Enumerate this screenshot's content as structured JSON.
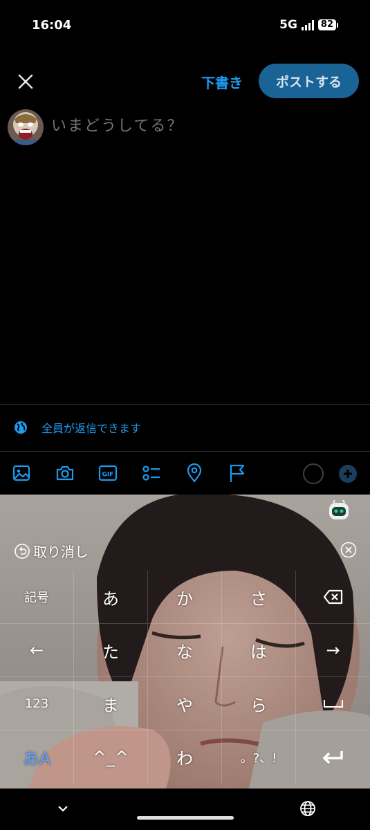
{
  "status": {
    "time": "16:04",
    "network": "5G",
    "battery": "82"
  },
  "header": {
    "draft_label": "下書き",
    "post_label": "ポストする"
  },
  "compose": {
    "placeholder": "いまどうしてる？"
  },
  "reply_setting": {
    "label": "全員が返信できます"
  },
  "toolbar": {
    "icons": [
      "image-icon",
      "camera-icon",
      "gif-icon",
      "poll-icon",
      "location-icon",
      "flag-icon"
    ],
    "gif_text": "GIF"
  },
  "keyboard": {
    "undo_label": "取り消し",
    "keys": {
      "symbols": "記号",
      "a": "あ",
      "ka": "か",
      "sa": "さ",
      "left": "←",
      "ta": "た",
      "na": "な",
      "ha": "は",
      "right": "→",
      "num": "123",
      "ma": "ま",
      "ya": "や",
      "ra": "ら",
      "mode": "あA",
      "face": "^_^",
      "wa": "わ",
      "punct": "。?、!"
    }
  },
  "colors": {
    "accent": "#1d9bf0",
    "post_button": "#1a6396",
    "background": "#000000"
  }
}
